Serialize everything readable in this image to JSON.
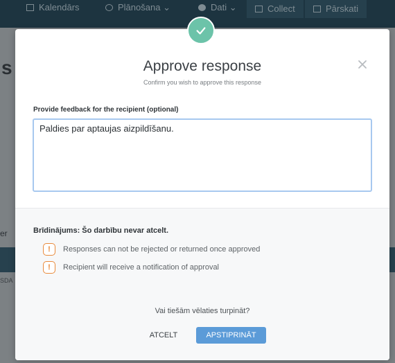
{
  "background": {
    "nav": [
      {
        "label": "Kalendārs",
        "icon": "calendar-icon"
      },
      {
        "label": "Plānošana",
        "icon": "clock-icon"
      },
      {
        "label": "Dati",
        "icon": "data-icon"
      },
      {
        "label": "Collect",
        "icon": "collect-icon"
      },
      {
        "label": "Pārskati",
        "icon": "reports-icon"
      }
    ],
    "page_letter": "s",
    "side_text_1": "er",
    "side_text_2": "SDA"
  },
  "modal": {
    "title": "Approve response",
    "subtitle": "Confirm you wish to approve this response",
    "feedback_label": "Provide feedback for the recipient (optional)",
    "feedback_value": "Paldies par aptaujas aizpildīšanu.",
    "warning_label": "Brīdinājums:",
    "warning_text": "Šo darbību nevar atcelt.",
    "warnings": [
      "Responses can not be rejected or returned once approved",
      "Recipient will receive a notification of approval"
    ],
    "warning_icon_glyph": "!",
    "confirm_question": "Vai tiešām vēlaties turpināt?",
    "cancel_label": "ATCELT",
    "approve_label": "APSTIPRINĀT"
  },
  "colors": {
    "accent": "#5b9bd8",
    "success": "#6cc3a9",
    "warning": "#e98a3b",
    "nav_bg": "#1d3440"
  }
}
